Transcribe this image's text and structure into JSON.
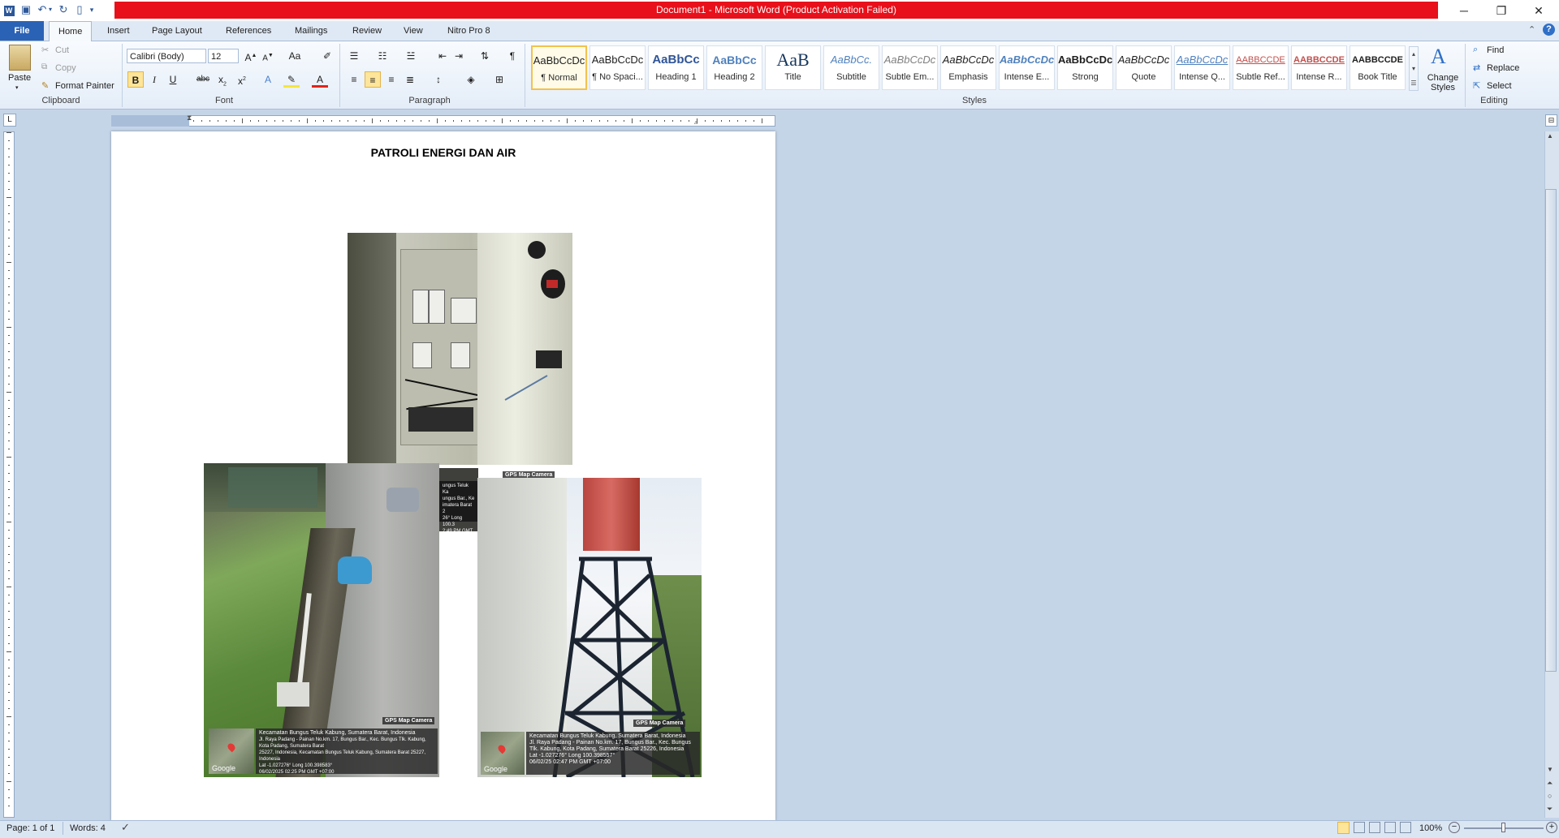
{
  "window": {
    "title": "Document1  -  Microsoft Word (Product Activation Failed)",
    "minimize": "─",
    "restore": "❐",
    "close": "✕"
  },
  "qat": {
    "icons": [
      "word-icon",
      "save-icon",
      "undo-icon",
      "redo-icon",
      "new-document-icon",
      "customize-icon"
    ]
  },
  "tabs": {
    "file": "File",
    "home": "Home",
    "insert": "Insert",
    "page_layout": "Page Layout",
    "references": "References",
    "mailings": "Mailings",
    "review": "Review",
    "view": "View",
    "nitro": "Nitro Pro 8"
  },
  "clipboard": {
    "label": "Clipboard",
    "paste": "Paste",
    "cut": "Cut",
    "copy": "Copy",
    "format_painter": "Format Painter"
  },
  "font": {
    "label": "Font",
    "family": "Calibri (Body)",
    "size": "12"
  },
  "paragraph": {
    "label": "Paragraph"
  },
  "styles": {
    "label": "Styles",
    "items": [
      {
        "preview": "AaBbCcDc",
        "name": "¶ Normal"
      },
      {
        "preview": "AaBbCcDc",
        "name": "¶ No Spaci..."
      },
      {
        "preview": "AaBbCc",
        "name": "Heading 1"
      },
      {
        "preview": "AaBbCc",
        "name": "Heading 2"
      },
      {
        "preview": "AaB",
        "name": "Title"
      },
      {
        "preview": "AaBbCc.",
        "name": "Subtitle"
      },
      {
        "preview": "AaBbCcDc",
        "name": "Subtle Em..."
      },
      {
        "preview": "AaBbCcDc",
        "name": "Emphasis"
      },
      {
        "preview": "AaBbCcDc",
        "name": "Intense E..."
      },
      {
        "preview": "AaBbCcDc",
        "name": "Strong"
      },
      {
        "preview": "AaBbCcDc",
        "name": "Quote"
      },
      {
        "preview": "AaBbCcDc",
        "name": "Intense Q..."
      },
      {
        "preview": "AABBCCDE",
        "name": "Subtle Ref..."
      },
      {
        "preview": "AABBCCDE",
        "name": "Intense R..."
      },
      {
        "preview": "AABBCCDE",
        "name": "Book Title"
      }
    ],
    "change_styles": "Change Styles"
  },
  "editing": {
    "label": "Editing",
    "find": "Find",
    "replace": "Replace",
    "select": "Select"
  },
  "document": {
    "title": "PATROLI ENERGI DAN AIR",
    "photo_left": {
      "badge": "GPS Map Camera",
      "map_logo": "Google",
      "lines": [
        "Kecamatan Bungus Teluk Kabung, Sumatera Barat, Indonesia",
        "Jl. Raya Padang - Painan No.km. 17, Bungus Bar., Kec. Bungus Tlk. Kabung, Kota Padang, Sumatera Barat",
        "25227, Indonesia, Kecamatan Bungus Teluk Kabung, Sumatera Barat 25227, Indonesia",
        "Lat -1.027276° Long 100.398583°",
        "06/02/2025 02:25 PM GMT +07:00"
      ]
    },
    "photo_right": {
      "badge": "GPS Map Camera",
      "map_logo": "Google",
      "lines": [
        "Kecamatan Bungus Teluk Kabung, Sumatera Barat, Indonesia",
        "Jl. Raya Padang - Painan No.km. 17, Bungus Bar., Kec. Bungus",
        "Tlk. Kabung, Kota Padang, Sumatera Barat 25226, Indonesia",
        "Lat -1.027276° Long 100.398557°",
        "06/02/25 02:47 PM GMT +07:00"
      ]
    },
    "photo_back": {
      "badge": "GPS Map Camera",
      "lines": [
        "ungus Teluk Ka",
        "ungus Bar., Ke",
        "imatera Barat 2",
        "26° Long 100.3",
        "2:49 PM GMT"
      ]
    }
  },
  "statusbar": {
    "page": "Page: 1 of 1",
    "words": "Words: 4",
    "zoom": "100%"
  },
  "colors": {
    "titlebar_accent": "#e8101a",
    "file_tab": "#2a62b6",
    "workspace": "#c5d5e8"
  }
}
